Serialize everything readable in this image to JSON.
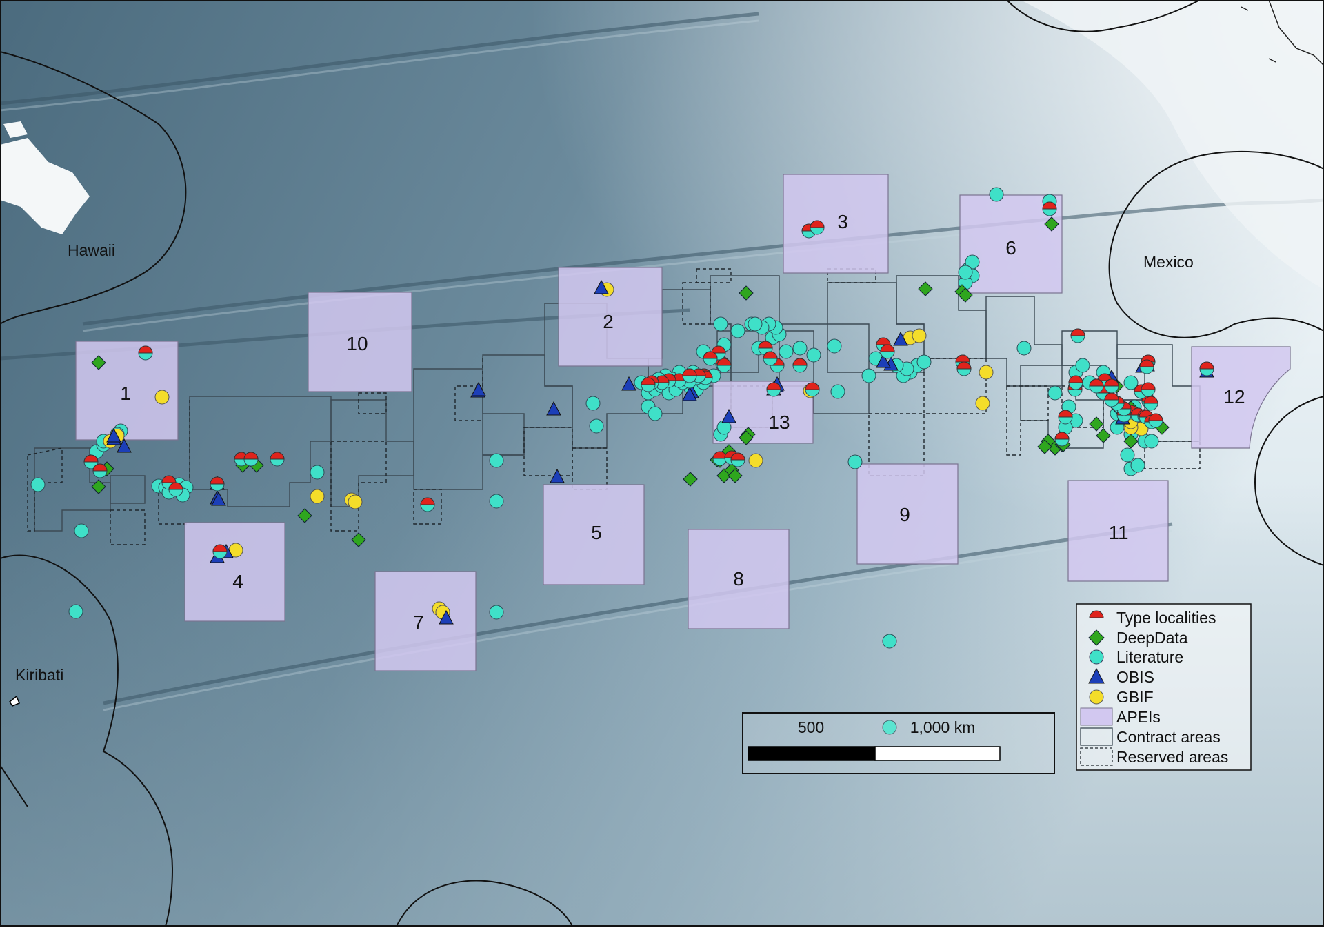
{
  "map": {
    "eez_labels": [
      "Hawaii",
      "Mexico",
      "Kiribati"
    ],
    "apeis": [
      {
        "id": "1"
      },
      {
        "id": "2"
      },
      {
        "id": "3"
      },
      {
        "id": "4"
      },
      {
        "id": "5"
      },
      {
        "id": "6"
      },
      {
        "id": "7"
      },
      {
        "id": "8"
      },
      {
        "id": "9"
      },
      {
        "id": "10"
      },
      {
        "id": "11"
      },
      {
        "id": "12"
      },
      {
        "id": "13"
      }
    ]
  },
  "legend": {
    "items": [
      {
        "label": "Type localities",
        "symbol": "half-circle-red"
      },
      {
        "label": "DeepData",
        "symbol": "diamond-green"
      },
      {
        "label": "Literature",
        "symbol": "circle-cyan"
      },
      {
        "label": "OBIS",
        "symbol": "triangle-blue"
      },
      {
        "label": "GBIF",
        "symbol": "circle-yellow"
      },
      {
        "label": "APEIs",
        "symbol": "lavender-box"
      },
      {
        "label": "Contract areas",
        "symbol": "solid-outline-box"
      },
      {
        "label": "Reserved areas",
        "symbol": "dashed-outline-box"
      }
    ]
  },
  "scale_bar": {
    "labels": [
      "500",
      "1,000 km"
    ]
  },
  "colors": {
    "ocean_dark": "#46677a",
    "ocean_light": "#d4e2e9",
    "apei_fill": "#d2c8f0",
    "type_locality": "#e0231c",
    "deepdata": "#2fa61e",
    "literature": "#3fe0c8",
    "obis": "#1c3fb8",
    "gbif": "#f4dd2a"
  }
}
